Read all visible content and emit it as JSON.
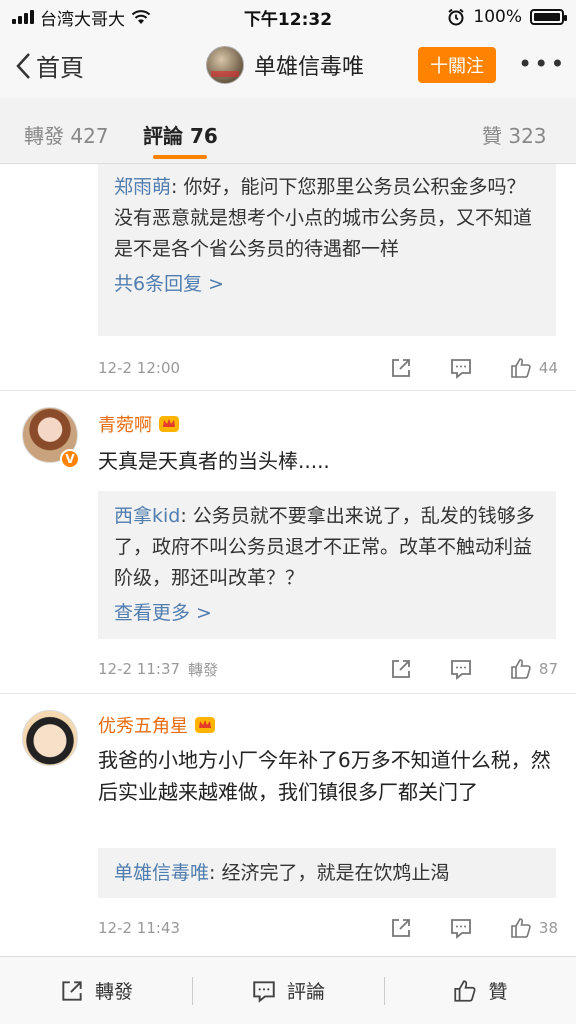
{
  "status_bar": {
    "carrier": "台湾大哥大",
    "time": "下午12:32",
    "battery_percent": "100%",
    "battery_level": 1.0
  },
  "nav": {
    "back_label": "首頁",
    "title": "单雄信毒唯",
    "follow_label": "十關注",
    "more_label": "•••"
  },
  "tabs": [
    {
      "label": "轉發",
      "count": "427"
    },
    {
      "label": "評論",
      "count": "76"
    },
    {
      "label": "贊",
      "count": "323"
    }
  ],
  "comments": [
    {
      "reply_name": "郑雨萌",
      "reply_text": ": 你好，能问下您那里公务员公积金多吗？没有恶意就是想考个小点的城市公务员，又不知道是不是各个省公务员的待遇都一样",
      "reply_more": "共6条回复 >",
      "time": "12-2 12:00",
      "repost_tag": "",
      "likes": "44"
    },
    {
      "username": "青菀啊",
      "text": "天真是天真者的当头棒.....",
      "reply_name": "西拿kid",
      "reply_text": ": 公务员就不要拿出来说了，乱发的钱够多了，政府不叫公务员退才不正常。改革不触动利益阶级，那还叫改革？？",
      "reply_more": "查看更多 >",
      "time": "12-2 11:37",
      "repost_tag": "轉發",
      "likes": "87"
    },
    {
      "username": "优秀五角星",
      "text": "我爸的小地方小厂今年补了6万多不知道什么税，然后实业越来越难做，我们镇很多厂都关门了",
      "reply_name": "单雄信毒唯",
      "reply_text": ": 经济完了，就是在饮鸩止渴",
      "time": "12-2 11:43",
      "repost_tag": "",
      "likes": "38"
    }
  ],
  "toolbar": {
    "repost": "轉發",
    "comment": "評論",
    "like": "贊"
  },
  "colors": {
    "accent": "#ff8200",
    "username": "#e86b0f",
    "link": "#507daf"
  }
}
